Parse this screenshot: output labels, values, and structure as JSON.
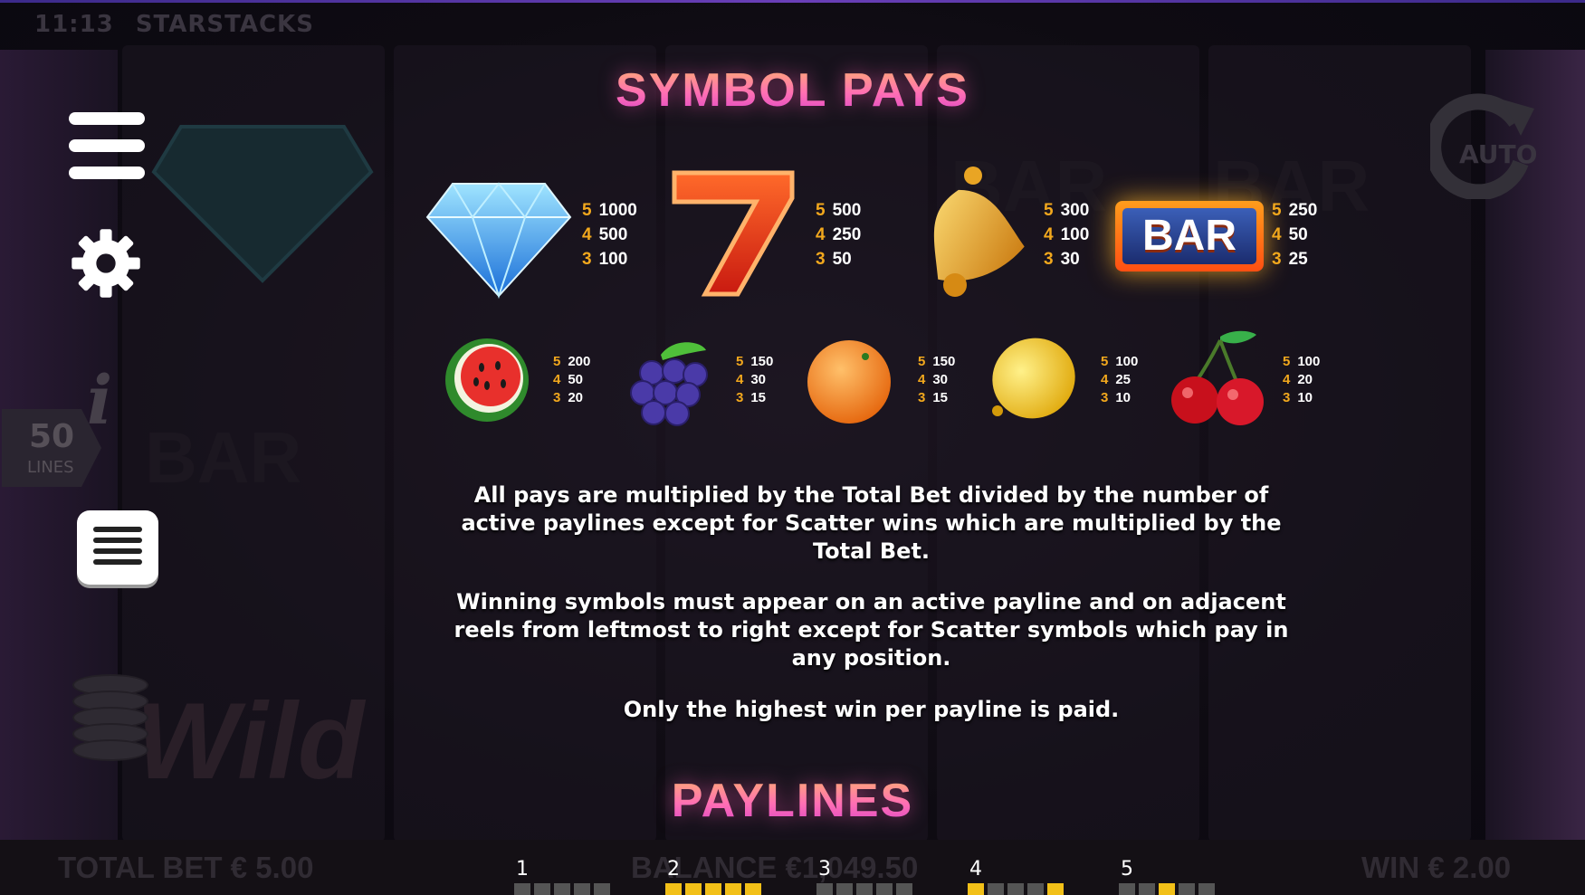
{
  "status_bar": {
    "time": "11:13",
    "game_name": "STARSTACKS"
  },
  "left_panel": {
    "lines_count": "50",
    "lines_label": "LINES"
  },
  "auto_label": "AUTO",
  "ghost_labels": {
    "bar": "BAR",
    "wild": "Wild"
  },
  "symbol_pays_title": "SYMBOL PAYS",
  "symbols_row1": [
    {
      "icon": "diamond-icon",
      "pays": [
        {
          "count": "5",
          "value": "1000"
        },
        {
          "count": "4",
          "value": "500"
        },
        {
          "count": "3",
          "value": "100"
        }
      ]
    },
    {
      "icon": "seven-icon",
      "pays": [
        {
          "count": "5",
          "value": "500"
        },
        {
          "count": "4",
          "value": "250"
        },
        {
          "count": "3",
          "value": "50"
        }
      ]
    },
    {
      "icon": "bell-icon",
      "pays": [
        {
          "count": "5",
          "value": "300"
        },
        {
          "count": "4",
          "value": "100"
        },
        {
          "count": "3",
          "value": "30"
        }
      ]
    },
    {
      "icon": "bar-icon",
      "label": "BAR",
      "pays": [
        {
          "count": "5",
          "value": "250"
        },
        {
          "count": "4",
          "value": "50"
        },
        {
          "count": "3",
          "value": "25"
        }
      ]
    }
  ],
  "symbols_row2": [
    {
      "icon": "watermelon-icon",
      "pays": [
        {
          "count": "5",
          "value": "200"
        },
        {
          "count": "4",
          "value": "50"
        },
        {
          "count": "3",
          "value": "20"
        }
      ]
    },
    {
      "icon": "grapes-icon",
      "pays": [
        {
          "count": "5",
          "value": "150"
        },
        {
          "count": "4",
          "value": "30"
        },
        {
          "count": "3",
          "value": "15"
        }
      ]
    },
    {
      "icon": "orange-icon",
      "pays": [
        {
          "count": "5",
          "value": "150"
        },
        {
          "count": "4",
          "value": "30"
        },
        {
          "count": "3",
          "value": "15"
        }
      ]
    },
    {
      "icon": "lemon-icon",
      "pays": [
        {
          "count": "5",
          "value": "100"
        },
        {
          "count": "4",
          "value": "25"
        },
        {
          "count": "3",
          "value": "10"
        }
      ]
    },
    {
      "icon": "cherry-icon",
      "pays": [
        {
          "count": "5",
          "value": "100"
        },
        {
          "count": "4",
          "value": "20"
        },
        {
          "count": "3",
          "value": "10"
        }
      ]
    }
  ],
  "rules_text": [
    "All pays are multiplied by the Total Bet divided by the number of active paylines except for Scatter wins which are multiplied by the Total Bet.",
    "Winning symbols must appear on an active payline and on adjacent reels from leftmost to right except for Scatter symbols which pay in any position.",
    "Only the highest win per payline is paid."
  ],
  "paylines_title": "PAYLINES",
  "paylines": [
    {
      "number": "1",
      "row": [
        0,
        0,
        0,
        0,
        0
      ]
    },
    {
      "number": "2",
      "row": [
        1,
        1,
        1,
        1,
        1
      ]
    },
    {
      "number": "3",
      "row": [
        0,
        0,
        0,
        0,
        0
      ]
    },
    {
      "number": "4",
      "row": [
        1,
        0,
        0,
        0,
        1
      ]
    },
    {
      "number": "5",
      "row": [
        0,
        0,
        1,
        0,
        0
      ]
    }
  ],
  "bottom_bar": {
    "total_bet": "TOTAL BET € 5.00",
    "balance": "BALANCE €1,049.50",
    "win": "WIN € 2.00"
  },
  "colors": {
    "pay_count": "#f2a81d",
    "heading_top": "#ffb36b",
    "heading_bottom": "#d743c8",
    "payline_on": "#f2c018"
  }
}
